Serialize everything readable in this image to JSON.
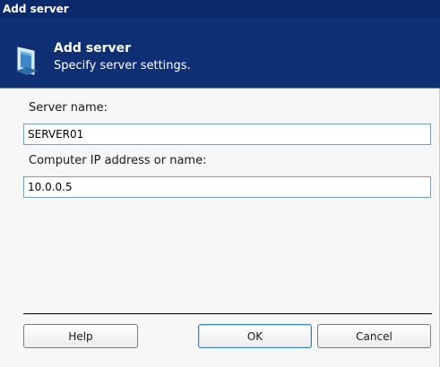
{
  "window": {
    "title": "Add server"
  },
  "header": {
    "title": "Add server",
    "subtitle": "Specify server settings.",
    "icon": "server-icon"
  },
  "form": {
    "server_name_label": "Server name:",
    "server_name_value": "SERVER01",
    "address_label": "Computer IP address or name:",
    "address_value": "10.0.0.5"
  },
  "buttons": {
    "help": "Help",
    "ok": "OK",
    "cancel": "Cancel"
  },
  "colors": {
    "header_background": "#0e2f73",
    "title_bar": "#0b2a6b",
    "field_border": "#7f9db9"
  }
}
